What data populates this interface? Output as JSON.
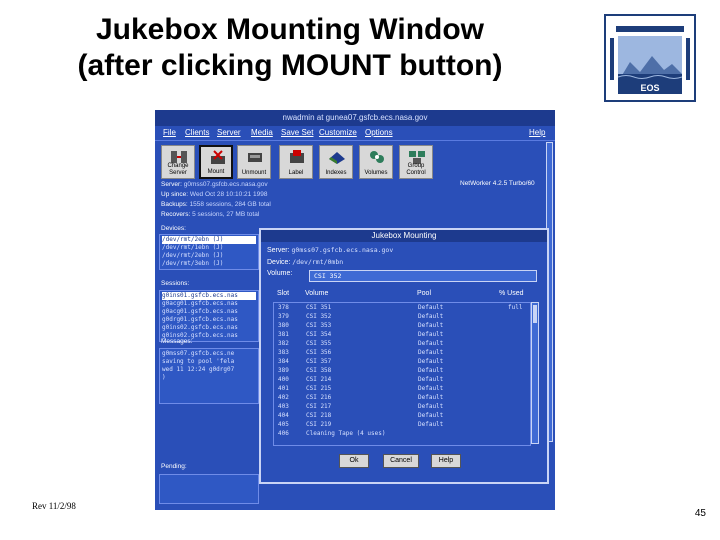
{
  "slide": {
    "title_line1": "Jukebox Mounting Window",
    "title_line2": "(after clicking MOUNT button)",
    "footer_left": "Rev 11/2/98",
    "page_number": "45",
    "logo_text": "EOS"
  },
  "app": {
    "window_title": "nwadmin at gunea07.gsfcb.ecs.nasa.gov",
    "menu": [
      "File",
      "Clients",
      "Server",
      "Media",
      "Save Set",
      "Customize",
      "Options",
      "Help"
    ],
    "toolbar": [
      {
        "label": "Change Server",
        "icon": "change-server-icon"
      },
      {
        "label": "Mount",
        "icon": "mount-icon"
      },
      {
        "label": "Unmount",
        "icon": "unmount-icon"
      },
      {
        "label": "Label",
        "icon": "label-icon"
      },
      {
        "label": "Indexes",
        "icon": "indexes-icon"
      },
      {
        "label": "Volumes",
        "icon": "volumes-icon"
      },
      {
        "label": "Group Control",
        "icon": "group-control-icon"
      }
    ],
    "server_label": "Server:",
    "server_value": "g0mss07.gsfcb.ecs.nasa.gov",
    "up_since": "Up since:",
    "up_since_value": "Wed Oct 28 10:10:21 1998",
    "backups": "Backups:",
    "backups_value": "1558 sessions, 284 GB total",
    "recovers": "Recovers:",
    "recovers_value": "5 sessions, 27 MB total",
    "product": "NetWorker 4.2.5 Turbo/60",
    "devices_label": "Devices:",
    "devices": [
      "/dev/rmt/2ebn (J)",
      "/dev/rmt/1ebn (J)",
      "/dev/rmt/2ebn (J)",
      "/dev/rmt/3ebn (J)"
    ],
    "sessions_label": "Sessions:",
    "sessions": [
      "g0ins01.gsfcb.ecs.nas",
      "g0acg01.gsfcb.ecs.nas",
      "g0acg01.gsfcb.ecs.nas",
      "g0drg01.gsfcb.ecs.nas",
      "g0ins02.gsfcb.ecs.nas",
      "g0ins02.gsfcb.ecs.nas"
    ],
    "messages_label": "Messages:",
    "messages": [
      "g0mss07.gsfcb.ecs.ne",
      "saving to pool 'fela",
      "wed 11 12:24 g0drg07",
      ")"
    ],
    "pending_label": "Pending:"
  },
  "dialog": {
    "title": "Jukebox Mounting",
    "server_label": "Server:",
    "server_value": "g0mss07.gsfcb.ecs.nasa.gov",
    "device_label": "Device:",
    "device_value": "/dev/rmt/0mbn",
    "volume_label": "Volume:",
    "volume_value": "CSI 352",
    "columns": {
      "slot": "Slot",
      "volume": "Volume",
      "pool": "Pool",
      "used": "% Used"
    },
    "rows": [
      {
        "slot": "378",
        "volume": "CSI 351",
        "pool": "Default",
        "used": "full"
      },
      {
        "slot": "379",
        "volume": "CSI 352",
        "pool": "Default",
        "used": ""
      },
      {
        "slot": "380",
        "volume": "CSI 353",
        "pool": "Default",
        "used": ""
      },
      {
        "slot": "381",
        "volume": "CSI 354",
        "pool": "Default",
        "used": ""
      },
      {
        "slot": "382",
        "volume": "CSI 355",
        "pool": "Default",
        "used": ""
      },
      {
        "slot": "383",
        "volume": "CSI 356",
        "pool": "Default",
        "used": ""
      },
      {
        "slot": "384",
        "volume": "CSI 357",
        "pool": "Default",
        "used": ""
      },
      {
        "slot": "389",
        "volume": "CSI 358",
        "pool": "Default",
        "used": ""
      },
      {
        "slot": "400",
        "volume": "CSI 214",
        "pool": "Default",
        "used": ""
      },
      {
        "slot": "401",
        "volume": "CSI 215",
        "pool": "Default",
        "used": ""
      },
      {
        "slot": "402",
        "volume": "CSI 216",
        "pool": "Default",
        "used": ""
      },
      {
        "slot": "403",
        "volume": "CSI 217",
        "pool": "Default",
        "used": ""
      },
      {
        "slot": "404",
        "volume": "CSI 218",
        "pool": "Default",
        "used": ""
      },
      {
        "slot": "405",
        "volume": "CSI 219",
        "pool": "Default",
        "used": ""
      },
      {
        "slot": "406",
        "volume": "Cleaning Tape (4 uses)",
        "pool": "",
        "used": ""
      }
    ],
    "buttons": {
      "ok": "Ok",
      "cancel": "Cancel",
      "help": "Help"
    }
  },
  "colors": {
    "window_blue": "#2a4fb8",
    "titlebar_blue": "#1d3a8e",
    "button_gray": "#d8d8d8"
  }
}
